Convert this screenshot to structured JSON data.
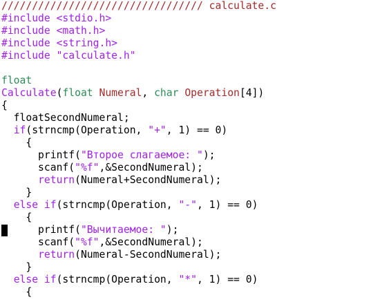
{
  "editor": {
    "file_name": "calculate.c",
    "lines": [
      {
        "tokens": [
          {
            "text": "///////////////////////////////// calculate.c",
            "cls": "t-comment"
          }
        ]
      },
      {
        "tokens": [
          {
            "text": "#include ",
            "cls": "t-pre"
          },
          {
            "text": "<stdio.h>",
            "cls": "t-str"
          }
        ]
      },
      {
        "tokens": [
          {
            "text": "#include ",
            "cls": "t-pre"
          },
          {
            "text": "<math.h>",
            "cls": "t-str"
          }
        ]
      },
      {
        "tokens": [
          {
            "text": "#include ",
            "cls": "t-pre"
          },
          {
            "text": "<string.h>",
            "cls": "t-str"
          }
        ]
      },
      {
        "tokens": [
          {
            "text": "#include ",
            "cls": "t-pre"
          },
          {
            "text": "\"calculate.h\"",
            "cls": "t-str"
          }
        ]
      },
      {
        "tokens": [
          {
            "text": "",
            "cls": "t-plain"
          }
        ]
      },
      {
        "tokens": [
          {
            "text": "float",
            "cls": "t-type"
          }
        ]
      },
      {
        "tokens": [
          {
            "text": "Calculate",
            "cls": "t-func"
          },
          {
            "text": "(",
            "cls": "t-plain"
          },
          {
            "text": "float",
            "cls": "t-type"
          },
          {
            "text": " ",
            "cls": "t-plain"
          },
          {
            "text": "Numeral",
            "cls": "t-param"
          },
          {
            "text": ", ",
            "cls": "t-plain"
          },
          {
            "text": "char",
            "cls": "t-type"
          },
          {
            "text": " ",
            "cls": "t-plain"
          },
          {
            "text": "Operation",
            "cls": "t-param"
          },
          {
            "text": "[4])",
            "cls": "t-plain"
          }
        ]
      },
      {
        "tokens": [
          {
            "text": "{",
            "cls": "t-plain"
          }
        ]
      },
      {
        "tokens": [
          {
            "text": "  floatSecondNumeral;",
            "cls": "t-plain"
          }
        ]
      },
      {
        "tokens": [
          {
            "text": "  ",
            "cls": "t-plain"
          },
          {
            "text": "if",
            "cls": "t-func"
          },
          {
            "text": "(strncmp(Operation, ",
            "cls": "t-plain"
          },
          {
            "text": "\"+\"",
            "cls": "t-str"
          },
          {
            "text": ", 1) == 0)",
            "cls": "t-plain"
          }
        ]
      },
      {
        "tokens": [
          {
            "text": "    {",
            "cls": "t-plain"
          }
        ]
      },
      {
        "tokens": [
          {
            "text": "      printf(",
            "cls": "t-plain"
          },
          {
            "text": "\"Второе слагаемое: \"",
            "cls": "t-str"
          },
          {
            "text": ");",
            "cls": "t-plain"
          }
        ]
      },
      {
        "tokens": [
          {
            "text": "      scanf(",
            "cls": "t-plain"
          },
          {
            "text": "\"%f\"",
            "cls": "t-str"
          },
          {
            "text": ",&SecondNumeral);",
            "cls": "t-plain"
          }
        ]
      },
      {
        "tokens": [
          {
            "text": "      ",
            "cls": "t-plain"
          },
          {
            "text": "return",
            "cls": "t-func"
          },
          {
            "text": "(Numeral+SecondNumeral);",
            "cls": "t-plain"
          }
        ]
      },
      {
        "tokens": [
          {
            "text": "    }",
            "cls": "t-plain"
          }
        ]
      },
      {
        "tokens": [
          {
            "text": "  ",
            "cls": "t-plain"
          },
          {
            "text": "else if",
            "cls": "t-func"
          },
          {
            "text": "(strncmp(Operation, ",
            "cls": "t-plain"
          },
          {
            "text": "\"-\"",
            "cls": "t-str"
          },
          {
            "text": ", 1) == 0)",
            "cls": "t-plain"
          }
        ]
      },
      {
        "tokens": [
          {
            "text": "    {",
            "cls": "t-plain"
          }
        ]
      },
      {
        "tokens": [
          {
            "text": "      printf(",
            "cls": "t-plain"
          },
          {
            "text": "\"Вычитаемое: \"",
            "cls": "t-str"
          },
          {
            "text": ");",
            "cls": "t-plain"
          }
        ]
      },
      {
        "tokens": [
          {
            "text": "      scanf(",
            "cls": "t-plain"
          },
          {
            "text": "\"%f\"",
            "cls": "t-str"
          },
          {
            "text": ",&SecondNumeral);",
            "cls": "t-plain"
          }
        ]
      },
      {
        "tokens": [
          {
            "text": "      ",
            "cls": "t-plain"
          },
          {
            "text": "return",
            "cls": "t-func"
          },
          {
            "text": "(Numeral-SecondNumeral);",
            "cls": "t-plain"
          }
        ]
      },
      {
        "tokens": [
          {
            "text": "    }",
            "cls": "t-plain"
          }
        ]
      },
      {
        "tokens": [
          {
            "text": "  ",
            "cls": "t-plain"
          },
          {
            "text": "else if",
            "cls": "t-func"
          },
          {
            "text": "(strncmp(Operation, ",
            "cls": "t-plain"
          },
          {
            "text": "\"*\"",
            "cls": "t-str"
          },
          {
            "text": ", 1) == 0)",
            "cls": "t-plain"
          }
        ]
      },
      {
        "tokens": [
          {
            "text": "    {",
            "cls": "t-plain"
          }
        ]
      }
    ]
  }
}
